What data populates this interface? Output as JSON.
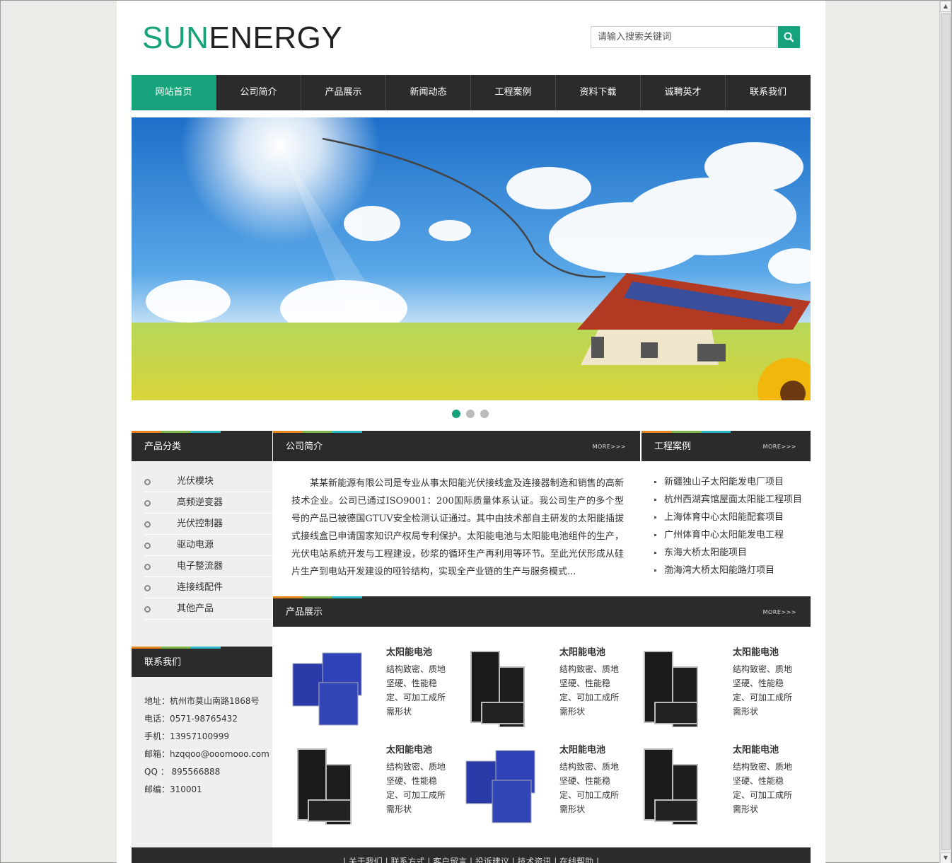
{
  "logo": {
    "part1": "SUN",
    "part2": "ENERGY"
  },
  "search": {
    "placeholder": "请输入搜索关键词"
  },
  "nav": {
    "items": [
      "网站首页",
      "公司简介",
      "产品展示",
      "新闻动态",
      "工程案例",
      "资料下载",
      "诚聘英才",
      "联系我们"
    ],
    "active_index": 0
  },
  "banner": {
    "slide_count": 3,
    "active_slide": 1
  },
  "categories": {
    "title": "产品分类",
    "items": [
      "光伏模块",
      "高频逆变器",
      "光伏控制器",
      "驱动电源",
      "电子整流器",
      "连接线配件",
      "其他产品"
    ]
  },
  "about": {
    "title": "公司简介",
    "more": "MORE>>>",
    "text": "某某新能源有限公司是专业从事太阳能光伏接线盒及连接器制造和销售的高新技术企业。公司已通过ISO9001：200国际质量体系认证。我公司生产的多个型号的产品已被德国GTUV安全检测认证通过。其中由技术部自主研发的太阳能插拔式接线盒已申请国家知识产权局专利保护。太阳能电池与太阳能电池组件的生产，光伏电站系统开发与工程建设，砂浆的循环生产再利用等环节。至此光伏形成从硅片生产到电站开发建设的哑铃结构，实现全产业链的生产与服务模式..."
  },
  "cases": {
    "title": "工程案例",
    "more": "MORE>>>",
    "items": [
      "新疆独山子太阳能发电厂项目",
      "杭州西湖宾馆屋面太阳能工程项目",
      "上海体育中心太阳能配套项目",
      "广州体育中心太阳能发电工程",
      "东海大桥太阳能项目",
      "渤海湾大桥太阳能路灯项目"
    ]
  },
  "contact": {
    "title": "联系我们",
    "lines": [
      "地址：杭州市莫山南路1868号",
      "电话：0571-98765432",
      "手机：13957100999",
      "邮箱：hzqqoo@ooomooo.com",
      "QQ ： 895566888",
      "邮编：310001"
    ]
  },
  "products": {
    "title": "产品展示",
    "more": "MORE>>>",
    "items": [
      {
        "name": "太阳能电池",
        "desc": "结构致密、质地坚硬、性能稳定、可加工成所需形状",
        "kind": "blue-cells"
      },
      {
        "name": "太阳能电池",
        "desc": "结构致密、质地坚硬、性能稳定、可加工成所需形状",
        "kind": "black-panels"
      },
      {
        "name": "太阳能电池",
        "desc": "结构致密、质地坚硬、性能稳定、可加工成所需形状",
        "kind": "black-panels"
      },
      {
        "name": "太阳能电池",
        "desc": "结构致密、质地坚硬、性能稳定、可加工成所需形状",
        "kind": "black-panels"
      },
      {
        "name": "太阳能电池",
        "desc": "结构致密、质地坚硬、性能稳定、可加工成所需形状",
        "kind": "blue-cells"
      },
      {
        "name": "太阳能电池",
        "desc": "结构致密、质地坚硬、性能稳定、可加工成所需形状",
        "kind": "black-panels"
      }
    ]
  },
  "footer": {
    "text": "| 关于我们 | 联系方式 | 客户留言 | 投诉建议 | 技术资讯 | 在线帮助 |"
  },
  "colors": {
    "accent": "#16a27a",
    "dark": "#2b2b2b",
    "stripe_orange": "#e5831f",
    "stripe_green": "#7cb342",
    "stripe_cyan": "#29b6c8"
  }
}
